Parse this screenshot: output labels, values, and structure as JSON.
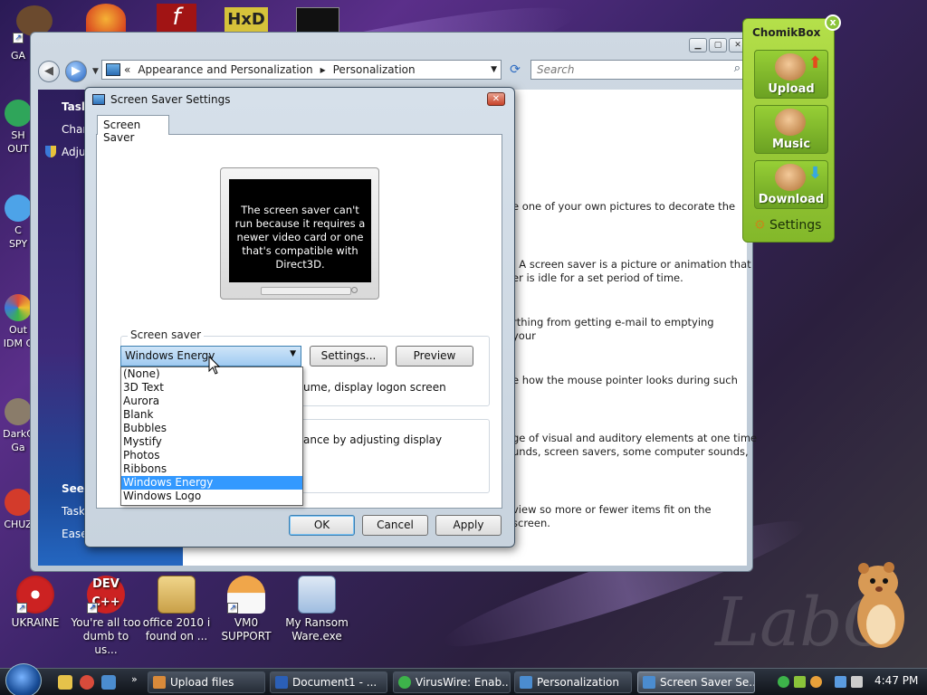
{
  "desktop": {
    "left_icons": [
      {
        "label": "GA",
        "color": "#c8a27a"
      },
      {
        "label": "SH\nOUT",
        "color": "#2fa55a"
      },
      {
        "label": "C\nSPY",
        "color": "#4da3e8"
      },
      {
        "label": "Out\nIDM C",
        "color": "#d94b3b"
      },
      {
        "label": "DarkC\nGa",
        "color": "#8a7c6a"
      },
      {
        "label": "CHUZ",
        "color": "#d33b2b"
      }
    ],
    "top_icons": [
      {
        "label": "",
        "color": "#d44b2a"
      },
      {
        "label": "",
        "color": "#b91d1d"
      },
      {
        "label": "",
        "color": "#f1c232"
      },
      {
        "label": "",
        "color": "#222222"
      }
    ],
    "bottom_icons": [
      {
        "label": "UKRAINE",
        "color": "#cc2222"
      },
      {
        "label": "You're all too dumb to us...",
        "color": "#cc2222"
      },
      {
        "label": "office 2010 i found on ...",
        "color": "#d6b46a"
      },
      {
        "label": "VM0 SUPPORT",
        "color": "#e8a03a"
      },
      {
        "label": "My Ransom Ware.exe",
        "color": "#7fa6d6"
      }
    ],
    "watermark": "LabC"
  },
  "explorer": {
    "address": {
      "prefix": "«",
      "segments": [
        "Appearance and Personalization",
        "Personalization"
      ]
    },
    "search_placeholder": "Search",
    "tasks": {
      "header": "Task",
      "items": [
        "Chan",
        "Adju"
      ],
      "see_also": "See",
      "see_items": [
        "Task",
        "Ease"
      ]
    },
    "content_lines": [
      "e one of your own pictures to decorate the",
      ". A screen saver is a picture or animation that\ner is idle for a set period of time.",
      "rthing from getting e-mail to emptying your",
      "e how the mouse pointer looks during such",
      "ge of visual and auditory elements at one time\nunds, screen savers, some computer sounds,",
      "view so more or fewer items fit on the screen."
    ]
  },
  "dialog": {
    "title": "Screen Saver Settings",
    "close": "✕",
    "tab": "Screen Saver",
    "preview_message": "The screen saver can't run because it requires a newer video card or one that's compatible with Direct3D.",
    "group_screen_saver": "Screen saver",
    "selected": "Windows Energy",
    "settings_btn": "Settings...",
    "preview_btn": "Preview",
    "logon_text": "ume, display logon screen",
    "power_text": "ance by adjusting display",
    "options": [
      "(None)",
      "3D Text",
      "Aurora",
      "Blank",
      "Bubbles",
      "Mystify",
      "Photos",
      "Ribbons",
      "Windows Energy",
      "Windows Logo"
    ],
    "ok": "OK",
    "cancel": "Cancel",
    "apply": "Apply"
  },
  "chomikbox": {
    "title": "ChomikBox",
    "close": "x",
    "tiles": [
      "Upload",
      "Music",
      "Download"
    ],
    "settings": "Settings"
  },
  "taskbar": {
    "tasks": [
      {
        "label": "Upload files",
        "color": "#d98a3a"
      },
      {
        "label": "Document1 - ...",
        "color": "#2b5fb6"
      },
      {
        "label": "VirusWire: Enab...",
        "color": "#3db34a"
      },
      {
        "label": "Personalization",
        "color": "#4b8ccf"
      },
      {
        "label": "Screen Saver Se...",
        "color": "#4b8ccf"
      }
    ],
    "clock": "4:47 PM"
  }
}
